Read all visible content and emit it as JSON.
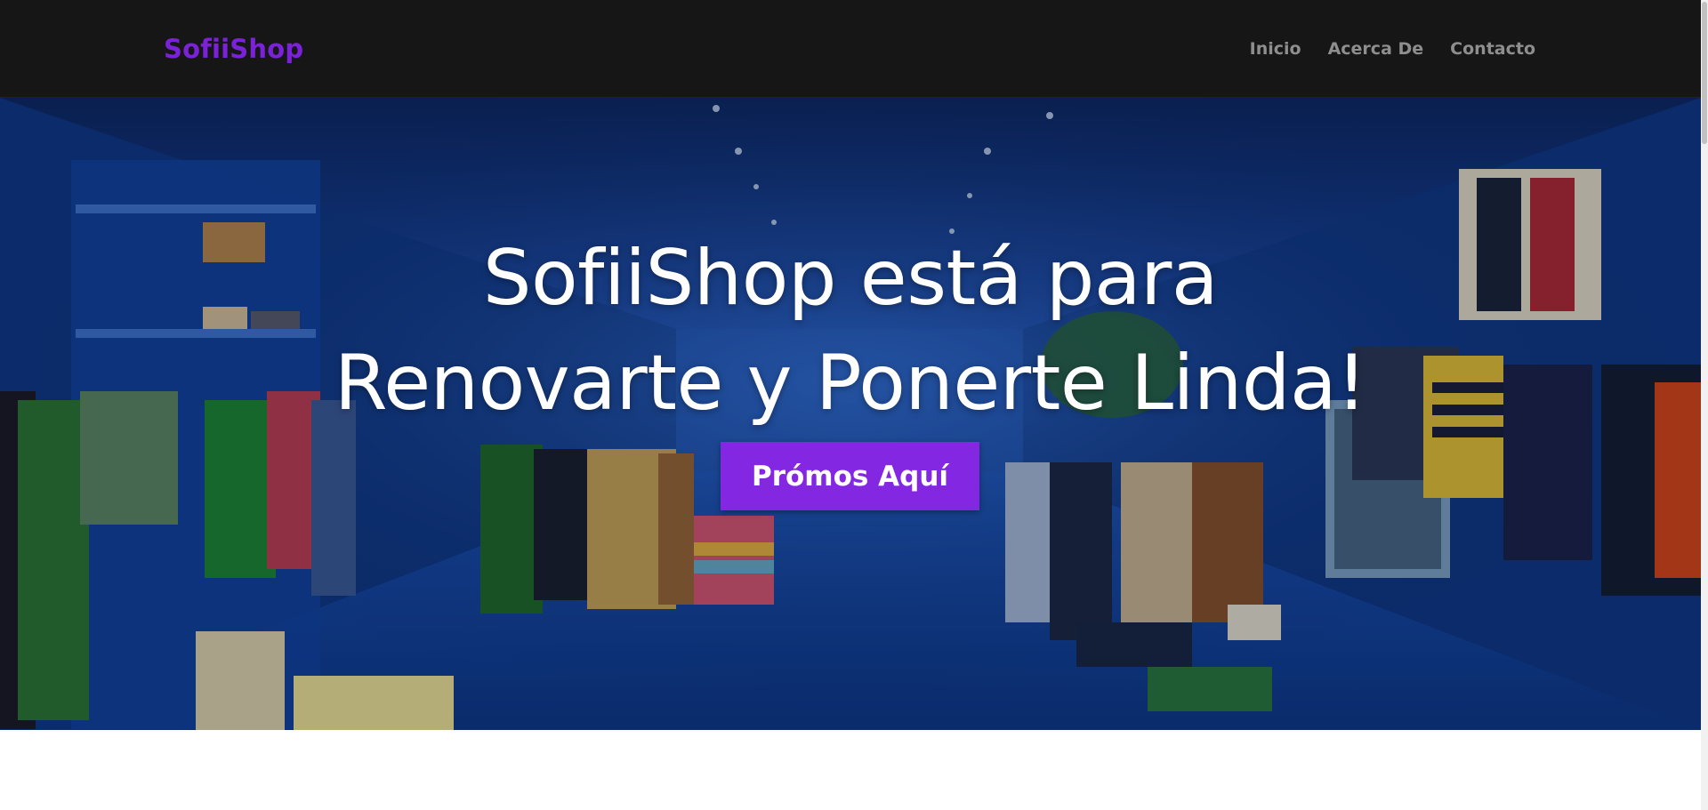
{
  "navbar": {
    "brand": "SofiiShop",
    "links": [
      {
        "label": "Inicio"
      },
      {
        "label": "Acerca De"
      },
      {
        "label": "Contacto"
      }
    ]
  },
  "hero": {
    "title_line1": "SofiiShop está para",
    "title_line2": "Renovarte y Ponerte Linda!",
    "cta_label": "Prómos Aquí",
    "background": "clothing-store-photo"
  },
  "colors": {
    "brand_purple": "#7b22d9",
    "button_purple": "#8327e2",
    "navbar_bg": "#161616",
    "nav_link": "#8e8e8e"
  }
}
